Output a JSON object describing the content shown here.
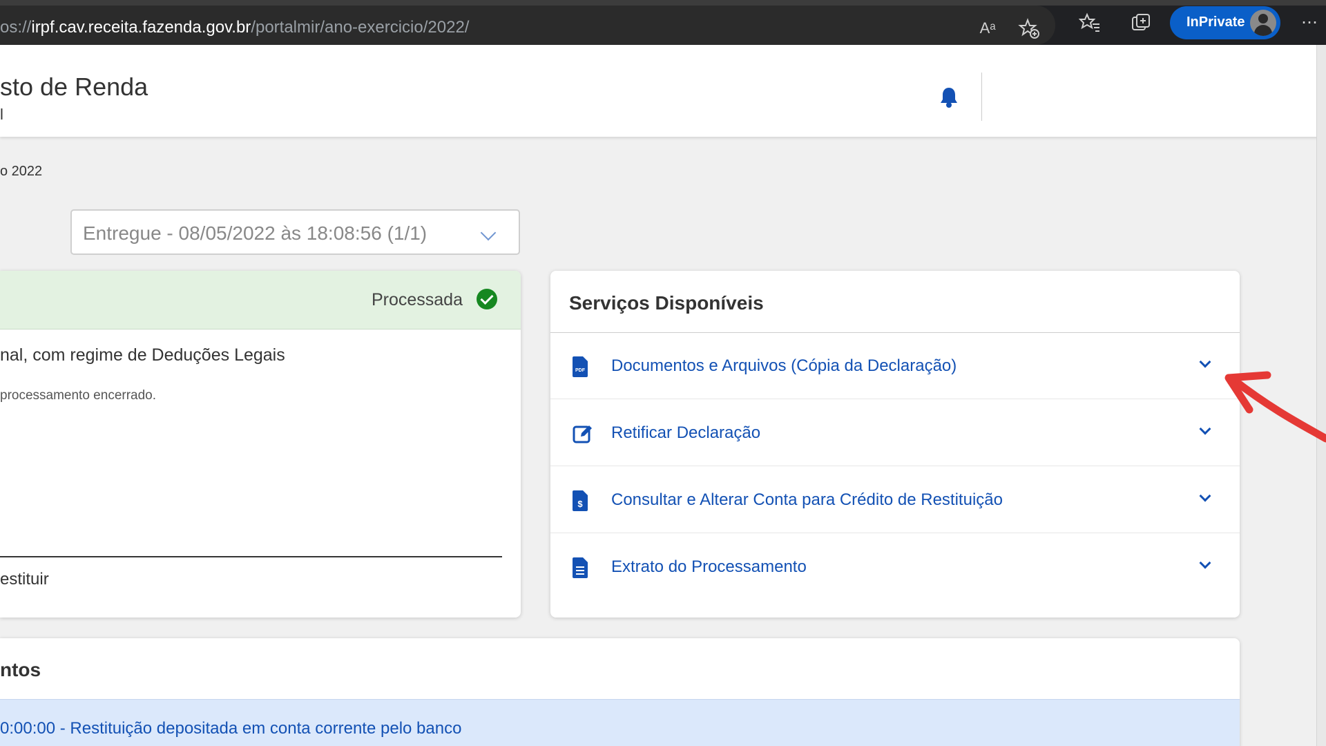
{
  "browser": {
    "url_prefix": "os://",
    "url_host": "irpf.cav.receita.fazenda.gov.br",
    "url_path": "/portalmir/ano-exercicio/2022/",
    "inprivate_label": "InPrivate",
    "read_aloud_glyph": "Aᵃ",
    "more_glyph": "⋯"
  },
  "header": {
    "title": "sto de Renda",
    "subtitle": "l"
  },
  "year_text": "o 2022",
  "declaration_select": {
    "value": "Entregue - 08/05/2022 às 18:08:56 (1/1)"
  },
  "left_card": {
    "status": "Processada",
    "description": "nal, com regime de Deduções Legais",
    "note": "processamento encerrado.",
    "bottom_label": "estituir"
  },
  "services": {
    "title": "Serviços Disponíveis",
    "items": [
      {
        "label": "Documentos e Arquivos (Cópia da Declaração)",
        "icon": "pdf-file-icon",
        "icon_text": "PDF"
      },
      {
        "label": "Retificar Declaração",
        "icon": "edit-icon"
      },
      {
        "label": "Consultar e Alterar Conta para Crédito de Restituição",
        "icon": "money-file-icon",
        "icon_text": "$"
      },
      {
        "label": "Extrato do Processamento",
        "icon": "document-icon"
      }
    ]
  },
  "events": {
    "title": "ntos",
    "first_event": "0:00:00 - Restituição depositada em conta corrente pelo banco"
  },
  "colors": {
    "primary_blue": "#1351b4",
    "success_green": "#168821",
    "status_bg": "#e3f2e1",
    "annotation_red": "#e53935"
  }
}
